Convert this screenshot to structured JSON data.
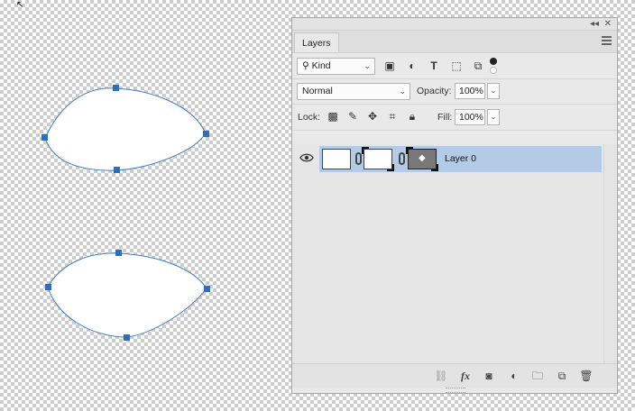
{
  "canvas": {
    "shapes": [
      "top-ellipse-path",
      "bottom-ellipse-path"
    ]
  },
  "panel": {
    "collapse_icon": "double-chevron-left-icon",
    "close_icon": "close-icon",
    "tab_label": "Layers",
    "menu_icon": "hamburger-menu-icon",
    "filter": {
      "kind_label": "Kind",
      "kind_icon": "search-icon",
      "icons": [
        "image-filter-icon",
        "adjustment-filter-icon",
        "type-filter-icon",
        "shape-filter-icon",
        "smart-object-filter-icon"
      ]
    },
    "blend": {
      "mode": "Normal",
      "opacity_label": "Opacity:",
      "opacity_value": "100%",
      "fill_label": "Fill:",
      "fill_value": "100%"
    },
    "lock": {
      "label": "Lock:",
      "icons": [
        "lock-transparent-pixels-icon",
        "lock-image-pixels-icon",
        "lock-position-icon",
        "lock-artboard-icon",
        "lock-all-icon"
      ]
    },
    "layers": [
      {
        "name": "Layer 0",
        "visible": true,
        "selected": true
      }
    ],
    "bottom_icons": [
      "link-layers-icon",
      "fx-icon",
      "add-mask-icon",
      "new-adjustment-layer-icon",
      "new-group-icon",
      "new-layer-icon",
      "delete-layer-icon"
    ],
    "colors": {
      "selection": "#b3cbe7",
      "path": "#3f80c4"
    }
  }
}
